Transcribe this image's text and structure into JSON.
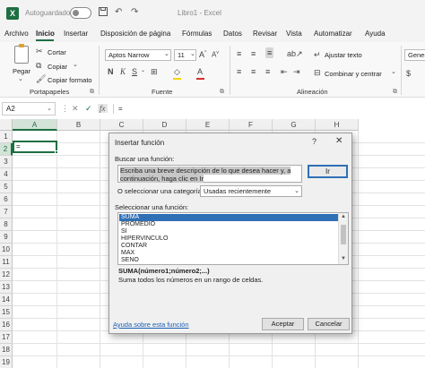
{
  "title_bar": {
    "logo": "X",
    "autosave_label": "Autoguardado",
    "autosave_state": "off",
    "document_title": "Libro1 - Excel",
    "icons": [
      "save-icon",
      "undo-icon",
      "redo-icon"
    ]
  },
  "menu": {
    "tabs": [
      "Archivo",
      "Inicio",
      "Insertar",
      "Disposición de página",
      "Fórmulas",
      "Datos",
      "Revisar",
      "Vista",
      "Automatizar",
      "Ayuda"
    ],
    "active": "Inicio"
  },
  "ribbon": {
    "clipboard": {
      "paste_label": "Pegar",
      "cut_label": "Cortar",
      "copy_label": "Copiar",
      "format_painter_label": "Copiar formato",
      "group_label": "Portapapeles"
    },
    "font": {
      "font_name": "Aptos Narrow",
      "font_size": "11",
      "group_label": "Fuente",
      "font_color": "#d32f2f",
      "fill_color": "#f5d200"
    },
    "alignment": {
      "wrap_text_label": "Ajustar texto",
      "merge_label": "Combinar y centrar",
      "group_label": "Alineación"
    },
    "number": {
      "format_value": "Genera"
    }
  },
  "formula_bar": {
    "name_box": "A2",
    "cancel_glyph": "✕",
    "enter_glyph": "✓",
    "fx_label": "fx",
    "content": "="
  },
  "grid": {
    "columns": [
      "A",
      "B",
      "C",
      "D",
      "E",
      "F",
      "G",
      "H"
    ],
    "rows": [
      "1",
      "2",
      "3",
      "4",
      "5",
      "6",
      "7",
      "8",
      "9",
      "10",
      "11",
      "12",
      "13",
      "14",
      "15",
      "16",
      "17",
      "18",
      "19"
    ],
    "active_cell_value": "="
  },
  "dialog": {
    "title": "Insertar función",
    "help_glyph": "?",
    "close_glyph": "✕",
    "search_label": "Buscar una función:",
    "search_line1": "Escriba una breve descripción de lo que desea hacer y, a",
    "search_line2": "continuación, haga clic en Ir",
    "go_button": "Ir",
    "category_label": "O seleccionar una categoría:",
    "category_value": "Usadas recientemente",
    "function_list_label": "Seleccionar una función:",
    "functions": [
      "SUMA",
      "PROMEDIO",
      "SI",
      "HIPERVINCULO",
      "CONTAR",
      "MAX",
      "SENO"
    ],
    "selected_function": "SUMA",
    "signature": "SUMA(número1;número2;...)",
    "description": "Suma todos los números en un rango de celdas.",
    "help_link": "Ayuda sobre esta función",
    "ok_button": "Aceptar",
    "cancel_button": "Cancelar"
  }
}
